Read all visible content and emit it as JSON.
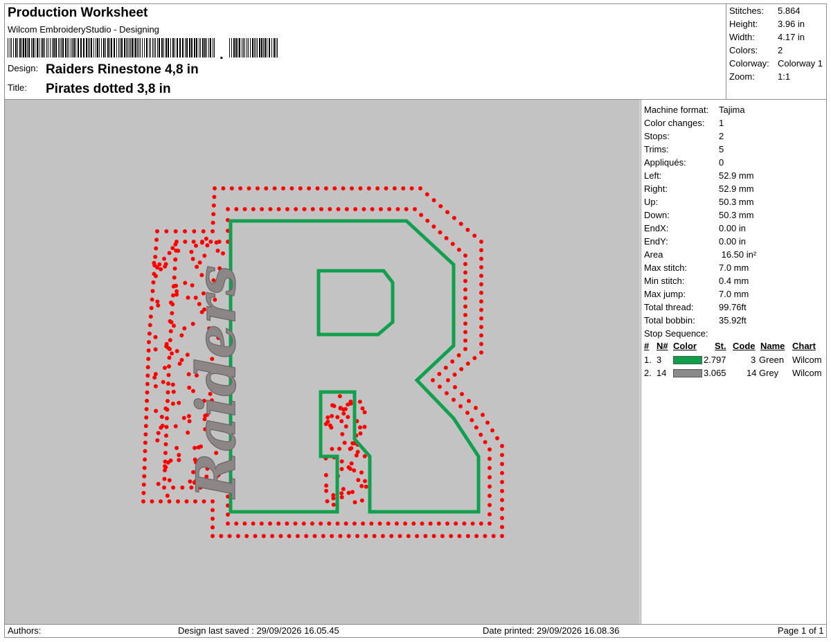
{
  "header": {
    "title": "Production Worksheet",
    "subtitle": "Wilcom EmbroideryStudio - Designing",
    "design_label": "Design:",
    "design_value": "Raiders Rinestone 4,8 in",
    "title_label": "Title:",
    "title_value": "Pirates dotted 3,8 in"
  },
  "summary": [
    {
      "key": "Stitches:",
      "value": "5.864"
    },
    {
      "key": "Height:",
      "value": "3.96 in"
    },
    {
      "key": "Width:",
      "value": "4.17 in"
    },
    {
      "key": "Colors:",
      "value": "2"
    },
    {
      "key": "Colorway:",
      "value": "Colorway 1"
    },
    {
      "key": "Zoom:",
      "value": "1:1"
    }
  ],
  "properties": [
    {
      "key": "Machine format:",
      "value": "Tajima"
    },
    {
      "key": "Color changes:",
      "value": "1"
    },
    {
      "key": "Stops:",
      "value": "2"
    },
    {
      "key": "Trims:",
      "value": "5"
    },
    {
      "key": "Appliqués:",
      "value": "0"
    },
    {
      "key": "Left:",
      "value": "52.9 mm"
    },
    {
      "key": "Right:",
      "value": "52.9 mm"
    },
    {
      "key": "Up:",
      "value": "50.3 mm"
    },
    {
      "key": "Down:",
      "value": "50.3 mm"
    },
    {
      "key": "EndX:",
      "value": "0.00 in"
    },
    {
      "key": "EndY:",
      "value": "0.00 in"
    },
    {
      "key": "Area",
      "value": " 16.50 in²"
    },
    {
      "key": "Max stitch:",
      "value": "7.0 mm"
    },
    {
      "key": "Min stitch:",
      "value": "0.4 mm"
    },
    {
      "key": "Max jump:",
      "value": "7.0 mm"
    },
    {
      "key": "Total thread:",
      "value": "99.76ft"
    },
    {
      "key": "Total bobbin:",
      "value": "35.92ft"
    }
  ],
  "stop_sequence": {
    "label": "Stop Sequence:",
    "columns": [
      "#",
      "N#",
      "Color",
      "St.",
      "Code",
      "Name",
      "Chart"
    ],
    "rows": [
      {
        "num": "1.",
        "n": "3",
        "color": "#0e9e4a",
        "st": "2.797",
        "code": "3",
        "name": "Green",
        "chart": "Wilcom"
      },
      {
        "num": "2.",
        "n": "14",
        "color": "#8a8a8a",
        "st": "3.065",
        "code": "14",
        "name": "Grey",
        "chart": "Wilcom"
      }
    ]
  },
  "footer": {
    "authors": "Authors:",
    "saved": "Design last saved : 29/09/2026 16.05.45",
    "printed": "Date printed: 29/09/2026 16.08.36",
    "page": "Page 1 of 1"
  },
  "design": {
    "script_text": "Raiders",
    "letter": "R",
    "colors": {
      "green": "#12a04f",
      "grey": "#8d8686",
      "dots": "#ff0000",
      "background": "#c3c3c3"
    }
  }
}
